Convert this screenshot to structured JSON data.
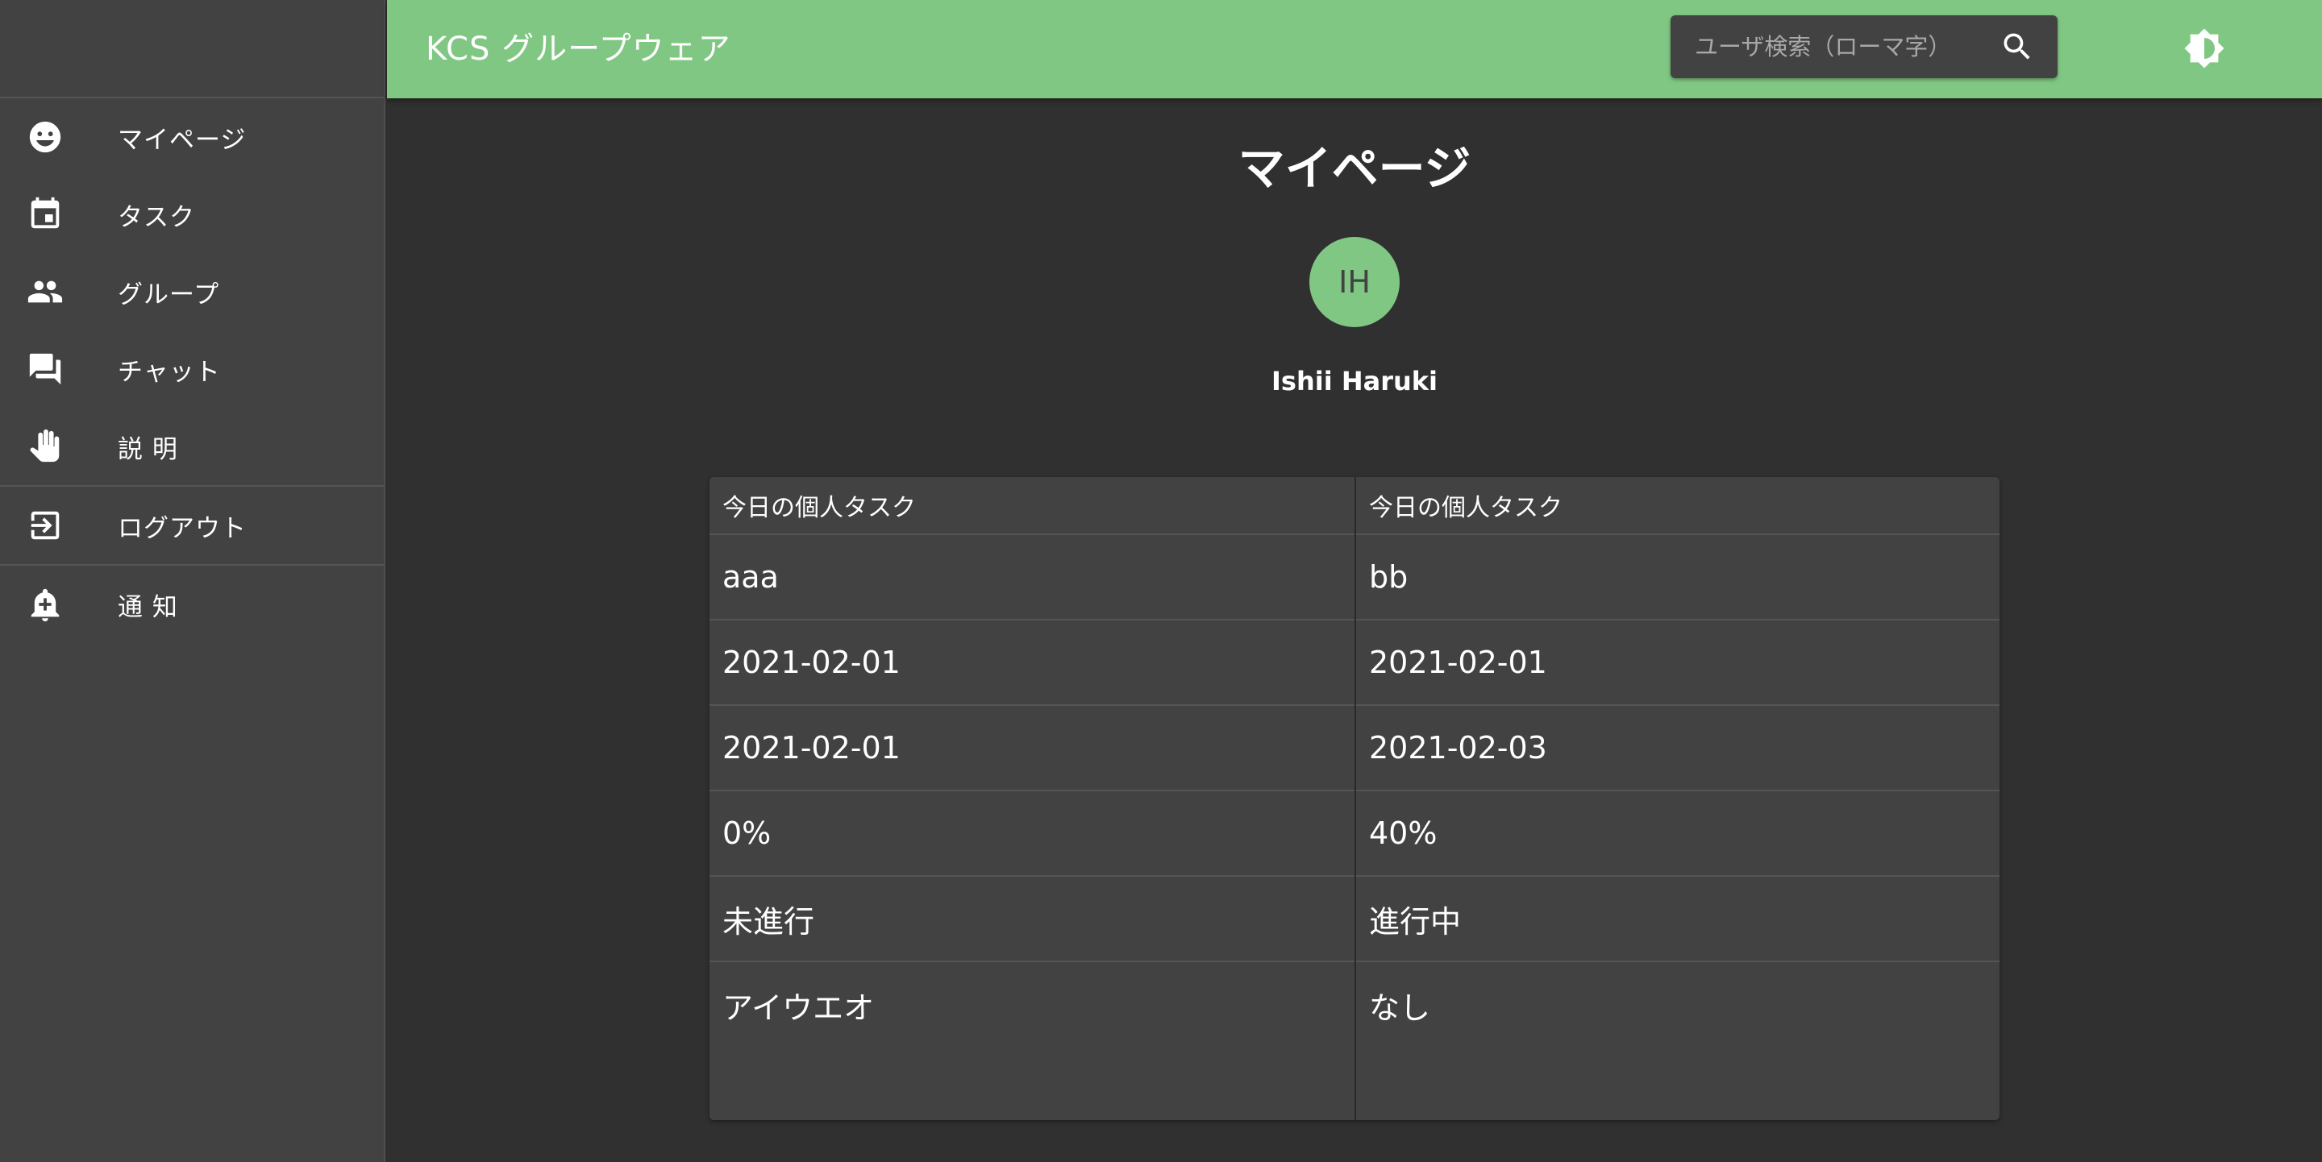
{
  "header": {
    "app_title": "KCS グループウェア",
    "search_placeholder": "ユーザ検索（ローマ字）",
    "search_icon": "search-icon",
    "theme_icon": "brightness-icon",
    "bg_color": "#81c784"
  },
  "sidebar": {
    "items": [
      {
        "label": "マイページ",
        "icon": "smiley-face-icon"
      },
      {
        "label": "タスク",
        "icon": "calendar-event-icon"
      },
      {
        "label": "グループ",
        "icon": "people-icon"
      },
      {
        "label": "チャット",
        "icon": "forum-chat-icon"
      },
      {
        "label": "説 明",
        "icon": "hand-icon"
      },
      {
        "label": "ログアウト",
        "icon": "logout-icon"
      },
      {
        "label": "通 知",
        "icon": "bell-plus-icon"
      }
    ]
  },
  "main": {
    "page_title": "マイページ",
    "avatar_initials": "IH",
    "user_name": "Ishii Haruki",
    "tasks": [
      {
        "header": "今日の個人タスク",
        "title": "aaa",
        "start_date": "2021-02-01",
        "end_date": "2021-02-01",
        "progress": "0%",
        "status": "未進行",
        "note": "アイウエオ"
      },
      {
        "header": "今日の個人タスク",
        "title": "bb",
        "start_date": "2021-02-01",
        "end_date": "2021-02-03",
        "progress": "40%",
        "status": "進行中",
        "note": "なし"
      }
    ]
  },
  "colors": {
    "accent": "#81c784",
    "background": "#303030",
    "surface": "#424242"
  }
}
